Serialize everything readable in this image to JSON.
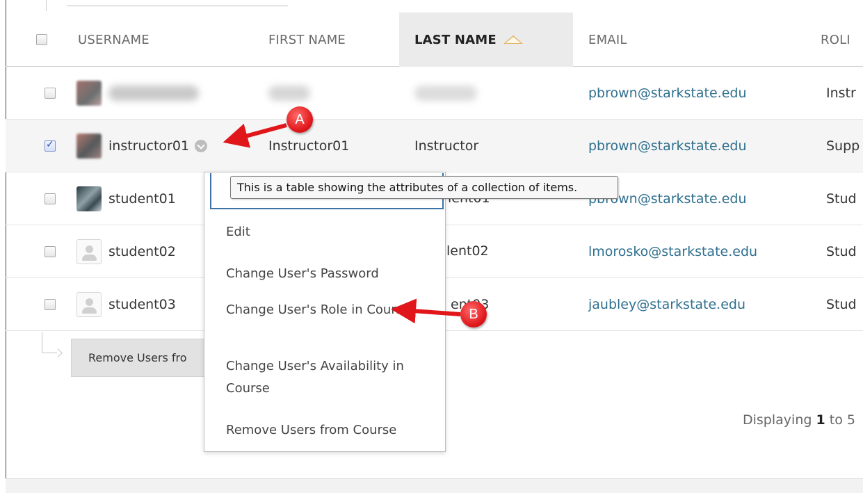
{
  "table": {
    "headers": [
      "USERNAME",
      "FIRST NAME",
      "LAST NAME",
      "EMAIL",
      "ROLI"
    ],
    "sorted_column": "LAST NAME",
    "rows": [
      {
        "checked": false,
        "username": "",
        "first_name": "",
        "last_name": "",
        "email": "pbrown@starkstate.edu",
        "role": "Instr",
        "avatar": "blurred"
      },
      {
        "checked": true,
        "username": "instructor01",
        "first_name": "Instructor01",
        "last_name": "Instructor",
        "email": "pbrown@starkstate.edu",
        "role": "Supp",
        "avatar": "photo-blurred"
      },
      {
        "checked": false,
        "username": "student01",
        "first_name": "",
        "last_name": "",
        "email": "pbrown@starkstate.edu",
        "role": "Stud",
        "avatar": "photo"
      },
      {
        "checked": false,
        "username": "student02",
        "first_name": "",
        "last_name": "",
        "email": "lmorosko@starkstate.edu",
        "role": "Stud",
        "avatar": "default"
      },
      {
        "checked": false,
        "username": "student03",
        "first_name": "",
        "last_name": "",
        "email": "jaubley@starkstate.edu",
        "role": "Stud",
        "avatar": "default"
      }
    ],
    "peek_text": {
      "row3": "lent01",
      "row4": "lent02",
      "row5": "ent03"
    }
  },
  "tooltip": "This is a table showing the attributes of a collection of items.",
  "context_menu": {
    "items": [
      "Edit",
      "Change User's Password",
      "Change User's Role in Course",
      "Change User's Availability in Course",
      "Remove Users from Course"
    ]
  },
  "footer": {
    "remove_button": "Remove Users fro",
    "displaying_prefix": "Displaying ",
    "displaying_start": "1",
    "displaying_suffix": " to 5"
  },
  "annotations": {
    "a": "A",
    "b": "B"
  },
  "colors": {
    "link": "#2e6f8e",
    "badge": "#e0161a",
    "sorted_header_bg": "#ebebeb"
  }
}
